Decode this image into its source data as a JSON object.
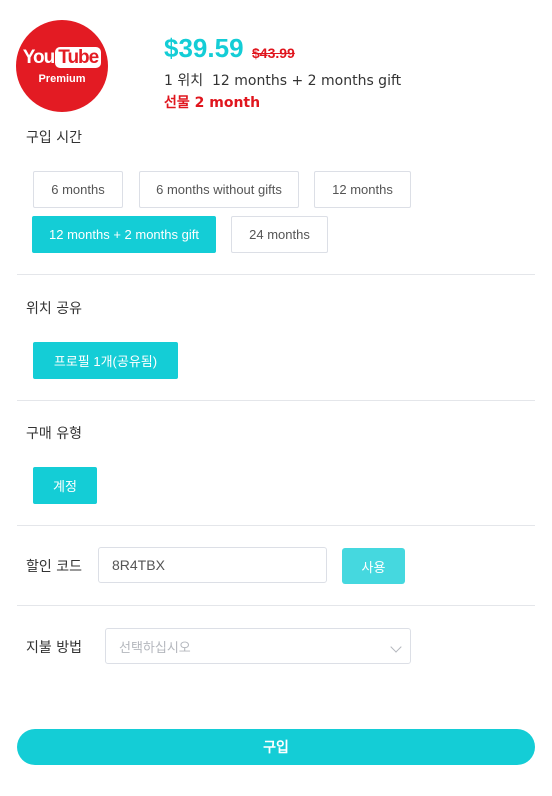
{
  "product": {
    "logo_text_you": "You",
    "logo_text_tube": "Tube",
    "logo_subtitle": "Premium",
    "price": "$39.59",
    "old_price": "$43.99",
    "subline": "1 위치  12 months + 2 months gift",
    "gift": "선물 2 month"
  },
  "duration": {
    "label": "구입 시간",
    "options": [
      {
        "label": "6 months",
        "selected": false
      },
      {
        "label": "6 months without gifts",
        "selected": false
      },
      {
        "label": "12 months",
        "selected": false
      },
      {
        "label": "12 months + 2 months gift",
        "selected": true
      },
      {
        "label": "24 months",
        "selected": false
      }
    ]
  },
  "sharing": {
    "label": "위치 공유",
    "options": [
      {
        "label": "프로필 1개(공유됨)",
        "selected": true
      }
    ]
  },
  "purchase_type": {
    "label": "구매 유형",
    "options": [
      {
        "label": "계정",
        "selected": true
      }
    ]
  },
  "coupon": {
    "label": "할인 코드",
    "value": "8R4TBX",
    "apply_label": "사용"
  },
  "payment": {
    "label": "지불 방법",
    "placeholder": "선택하십시오"
  },
  "buy_label": "구입",
  "colors": {
    "accent": "#14cdd6",
    "sale_red": "#e0161e",
    "logo_red": "#e31b23"
  }
}
